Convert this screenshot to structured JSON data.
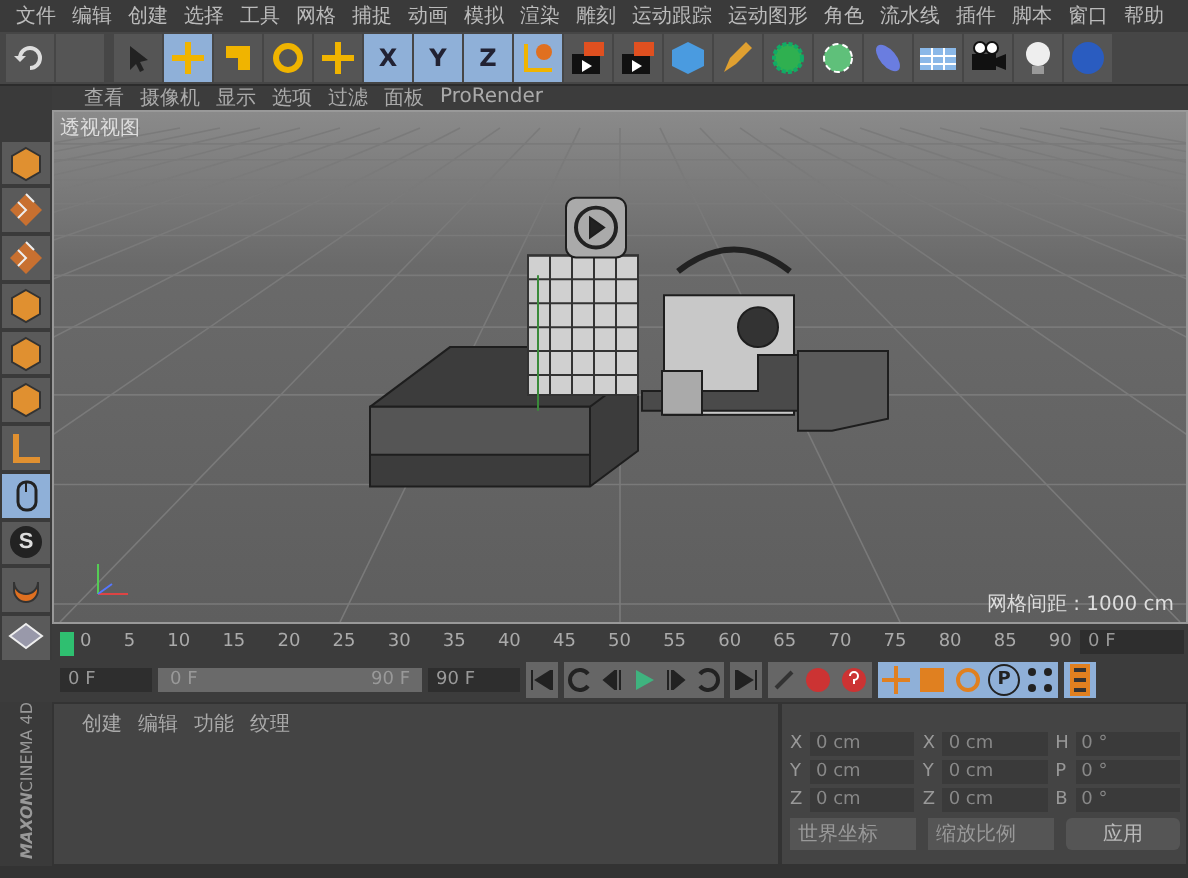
{
  "menu_bar": {
    "items": [
      "文件",
      "编辑",
      "创建",
      "选择",
      "工具",
      "网格",
      "捕捉",
      "动画",
      "模拟",
      "渲染",
      "雕刻",
      "运动跟踪",
      "运动图形",
      "角色",
      "流水线",
      "插件",
      "脚本",
      "窗口",
      "帮助"
    ]
  },
  "toolbar": {
    "tools": [
      {
        "kind": "select",
        "selected": false
      },
      {
        "kind": "move",
        "selected": true
      },
      {
        "kind": "scale",
        "selected": false
      },
      {
        "kind": "rotate",
        "selected": false
      },
      {
        "kind": "move",
        "selected": false
      }
    ],
    "axis_locks": [
      {
        "label": "X",
        "selected": true
      },
      {
        "label": "Y",
        "selected": true
      },
      {
        "label": "Z",
        "selected": true
      }
    ]
  },
  "viewport": {
    "menu": [
      "查看",
      "摄像机",
      "显示",
      "选项",
      "过滤",
      "面板",
      "ProRender"
    ],
    "view_name": "透视视图",
    "grid_spacing": "网格间距 : 1000 cm"
  },
  "left_toolbar": {
    "snap_label": "S"
  },
  "timeline": {
    "ticks": [
      "0",
      "5",
      "10",
      "15",
      "20",
      "25",
      "30",
      "35",
      "40",
      "45",
      "50",
      "55",
      "60",
      "65",
      "70",
      "75",
      "80",
      "85",
      "90"
    ],
    "current_frame": "0 F",
    "start_field": "0 F",
    "range": {
      "start": "0 F",
      "end": "90 F",
      "level": 1
    },
    "end_field": "90 F",
    "level": 0,
    "p_label": "P"
  },
  "materials": {
    "menu": [
      "创建",
      "编辑",
      "功能",
      "纹理"
    ]
  },
  "coordinates": {
    "columns": [
      [
        {
          "axis": "X",
          "value": "0 cm"
        },
        {
          "axis": "Y",
          "value": "0 cm"
        },
        {
          "axis": "Z",
          "value": "0 cm"
        }
      ],
      [
        {
          "axis": "X",
          "value": "0 cm"
        },
        {
          "axis": "Y",
          "value": "0 cm"
        },
        {
          "axis": "Z",
          "value": "0 cm"
        }
      ],
      [
        {
          "axis": "H",
          "value": "0 °"
        },
        {
          "axis": "P",
          "value": "0 °"
        },
        {
          "axis": "B",
          "value": "0 °"
        }
      ]
    ],
    "dropdowns": [
      "世界坐标",
      "缩放比例"
    ],
    "apply": "应用"
  },
  "logo": {
    "brand": "MAXON",
    "product": "CINEMA 4D"
  }
}
